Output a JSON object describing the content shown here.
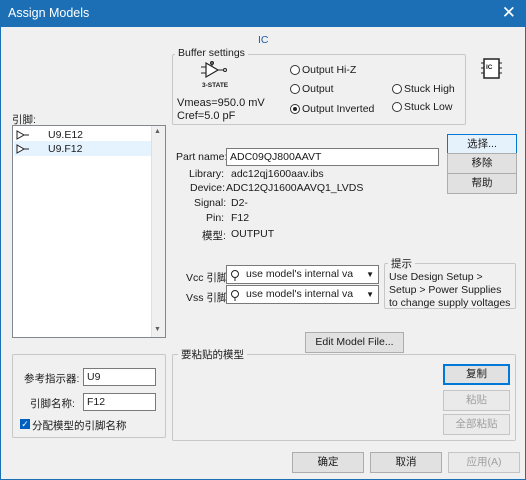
{
  "window": {
    "title": "Assign Models",
    "close_glyph": "✕"
  },
  "ic_caption": "IC",
  "buffer": {
    "legend": "Buffer settings",
    "icon_caption": "3-STATE",
    "vmeas": "Vmeas=950.0 mV",
    "cref": "Cref=5.0 pF",
    "options": [
      {
        "label": "Output Hi-Z",
        "selected": false
      },
      {
        "label": "Output",
        "selected": false
      },
      {
        "label": "Output Inverted",
        "selected": true
      },
      {
        "label": "Stuck High",
        "selected": false
      },
      {
        "label": "Stuck Low",
        "selected": false
      }
    ],
    "badge": "IC"
  },
  "pins": {
    "label": "引脚:",
    "items": [
      {
        "name": "U9.E12",
        "selected": false
      },
      {
        "name": "U9.F12",
        "selected": true
      }
    ]
  },
  "part": {
    "name_label": "Part name:",
    "name_value": "ADC09QJ800AAVT",
    "fields": [
      {
        "label": "Library:",
        "value": "adc12qj1600aav.ibs"
      },
      {
        "label": "Device:",
        "value": "ADC12QJ1600AAVQ1_LVDS"
      },
      {
        "label": "Signal:",
        "value": "D2-"
      },
      {
        "label": "Pin:",
        "value": "F12"
      },
      {
        "label": "模型:",
        "value": "OUTPUT"
      }
    ]
  },
  "side_buttons": {
    "select": "选择...",
    "remove": "移除",
    "help": "帮助"
  },
  "supply": {
    "vcc_label": "Vcc 引脚:",
    "vcc_value": "use model's internal va",
    "vss_label": "Vss 引脚:",
    "vss_value": "use model's internal va"
  },
  "hint": {
    "legend": "提示",
    "text": "Use Design Setup > Setup > Power Supplies to change supply voltages"
  },
  "edit_model_button": "Edit Model File...",
  "ref": {
    "designator_label": "参考指示器:",
    "designator_value": "U9",
    "pin_name_label": "引脚名称:",
    "pin_name_value": "F12",
    "checkbox_label": "分配模型的引脚名称",
    "checkbox_checked": true
  },
  "paste": {
    "legend": "要粘贴的模型",
    "copy": "复制",
    "paste": "粘贴",
    "paste_all": "全部粘贴"
  },
  "footer": {
    "ok": "确定",
    "cancel": "取消",
    "apply": "应用(A)"
  }
}
